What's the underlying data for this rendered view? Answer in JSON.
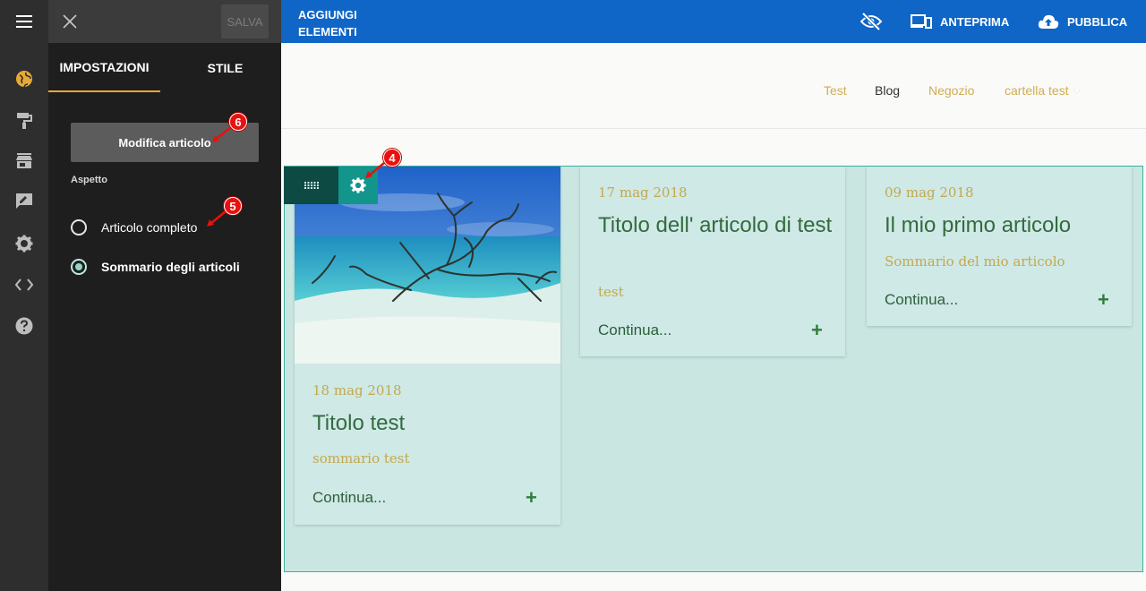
{
  "rail": {
    "items": [
      {
        "icon": "globe-icon",
        "active": true
      },
      {
        "icon": "paint-roller-icon"
      },
      {
        "icon": "store-icon"
      },
      {
        "icon": "feedback-icon"
      },
      {
        "icon": "gear-icon"
      },
      {
        "icon": "code-icon"
      },
      {
        "icon": "help-icon"
      }
    ]
  },
  "panel": {
    "save_label": "SALVA",
    "tabs": [
      "IMPOSTAZIONI",
      "STILE"
    ],
    "edit_button": "Modifica articolo",
    "section_label": "Aspetto",
    "options": [
      {
        "label": "Articolo completo",
        "checked": false
      },
      {
        "label": "Sommario degli articoli",
        "checked": true
      }
    ]
  },
  "markers": [
    "6",
    "5",
    "4"
  ],
  "topbar": {
    "add_elements": "AGGIUNGI ELEMENTI",
    "preview": "ANTEPRIMA",
    "publish": "PUBBLICA"
  },
  "nav": [
    "Test",
    "Blog",
    "Negozio",
    "cartella test"
  ],
  "posts": [
    {
      "date": "18 mag 2018",
      "title": "Titolo test",
      "summary": "sommario test",
      "more": "Continua...",
      "plus": "+"
    },
    {
      "date": "17 mag 2018",
      "title": "Titolo dell' articolo di test",
      "summary": "test",
      "more": "Continua...",
      "plus": "+"
    },
    {
      "date": "09 mag 2018",
      "title": "Il mio primo articolo",
      "summary": "Sommario del mio articolo",
      "more": "Continua...",
      "plus": "+"
    }
  ],
  "colors": {
    "accent": "#e8a935",
    "topbar": "#0f66c6",
    "nav_link": "#d1ad4e",
    "section_bg": "#c9e6e1",
    "marker": "#e8110f"
  }
}
